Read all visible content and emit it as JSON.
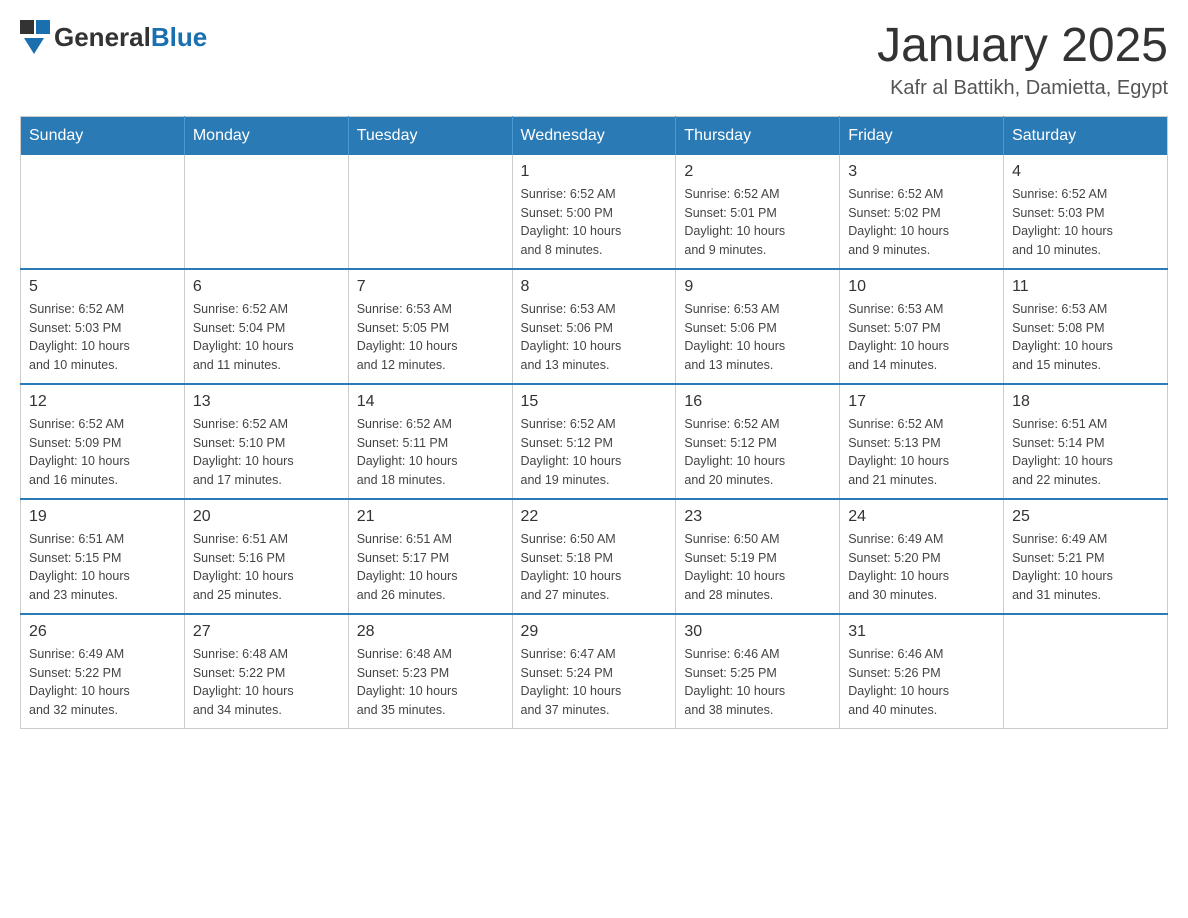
{
  "header": {
    "logo_general": "General",
    "logo_blue": "Blue",
    "title": "January 2025",
    "subtitle": "Kafr al Battikh, Damietta, Egypt"
  },
  "calendar": {
    "days_of_week": [
      "Sunday",
      "Monday",
      "Tuesday",
      "Wednesday",
      "Thursday",
      "Friday",
      "Saturday"
    ],
    "weeks": [
      [
        {
          "day": "",
          "info": ""
        },
        {
          "day": "",
          "info": ""
        },
        {
          "day": "",
          "info": ""
        },
        {
          "day": "1",
          "info": "Sunrise: 6:52 AM\nSunset: 5:00 PM\nDaylight: 10 hours\nand 8 minutes."
        },
        {
          "day": "2",
          "info": "Sunrise: 6:52 AM\nSunset: 5:01 PM\nDaylight: 10 hours\nand 9 minutes."
        },
        {
          "day": "3",
          "info": "Sunrise: 6:52 AM\nSunset: 5:02 PM\nDaylight: 10 hours\nand 9 minutes."
        },
        {
          "day": "4",
          "info": "Sunrise: 6:52 AM\nSunset: 5:03 PM\nDaylight: 10 hours\nand 10 minutes."
        }
      ],
      [
        {
          "day": "5",
          "info": "Sunrise: 6:52 AM\nSunset: 5:03 PM\nDaylight: 10 hours\nand 10 minutes."
        },
        {
          "day": "6",
          "info": "Sunrise: 6:52 AM\nSunset: 5:04 PM\nDaylight: 10 hours\nand 11 minutes."
        },
        {
          "day": "7",
          "info": "Sunrise: 6:53 AM\nSunset: 5:05 PM\nDaylight: 10 hours\nand 12 minutes."
        },
        {
          "day": "8",
          "info": "Sunrise: 6:53 AM\nSunset: 5:06 PM\nDaylight: 10 hours\nand 13 minutes."
        },
        {
          "day": "9",
          "info": "Sunrise: 6:53 AM\nSunset: 5:06 PM\nDaylight: 10 hours\nand 13 minutes."
        },
        {
          "day": "10",
          "info": "Sunrise: 6:53 AM\nSunset: 5:07 PM\nDaylight: 10 hours\nand 14 minutes."
        },
        {
          "day": "11",
          "info": "Sunrise: 6:53 AM\nSunset: 5:08 PM\nDaylight: 10 hours\nand 15 minutes."
        }
      ],
      [
        {
          "day": "12",
          "info": "Sunrise: 6:52 AM\nSunset: 5:09 PM\nDaylight: 10 hours\nand 16 minutes."
        },
        {
          "day": "13",
          "info": "Sunrise: 6:52 AM\nSunset: 5:10 PM\nDaylight: 10 hours\nand 17 minutes."
        },
        {
          "day": "14",
          "info": "Sunrise: 6:52 AM\nSunset: 5:11 PM\nDaylight: 10 hours\nand 18 minutes."
        },
        {
          "day": "15",
          "info": "Sunrise: 6:52 AM\nSunset: 5:12 PM\nDaylight: 10 hours\nand 19 minutes."
        },
        {
          "day": "16",
          "info": "Sunrise: 6:52 AM\nSunset: 5:12 PM\nDaylight: 10 hours\nand 20 minutes."
        },
        {
          "day": "17",
          "info": "Sunrise: 6:52 AM\nSunset: 5:13 PM\nDaylight: 10 hours\nand 21 minutes."
        },
        {
          "day": "18",
          "info": "Sunrise: 6:51 AM\nSunset: 5:14 PM\nDaylight: 10 hours\nand 22 minutes."
        }
      ],
      [
        {
          "day": "19",
          "info": "Sunrise: 6:51 AM\nSunset: 5:15 PM\nDaylight: 10 hours\nand 23 minutes."
        },
        {
          "day": "20",
          "info": "Sunrise: 6:51 AM\nSunset: 5:16 PM\nDaylight: 10 hours\nand 25 minutes."
        },
        {
          "day": "21",
          "info": "Sunrise: 6:51 AM\nSunset: 5:17 PM\nDaylight: 10 hours\nand 26 minutes."
        },
        {
          "day": "22",
          "info": "Sunrise: 6:50 AM\nSunset: 5:18 PM\nDaylight: 10 hours\nand 27 minutes."
        },
        {
          "day": "23",
          "info": "Sunrise: 6:50 AM\nSunset: 5:19 PM\nDaylight: 10 hours\nand 28 minutes."
        },
        {
          "day": "24",
          "info": "Sunrise: 6:49 AM\nSunset: 5:20 PM\nDaylight: 10 hours\nand 30 minutes."
        },
        {
          "day": "25",
          "info": "Sunrise: 6:49 AM\nSunset: 5:21 PM\nDaylight: 10 hours\nand 31 minutes."
        }
      ],
      [
        {
          "day": "26",
          "info": "Sunrise: 6:49 AM\nSunset: 5:22 PM\nDaylight: 10 hours\nand 32 minutes."
        },
        {
          "day": "27",
          "info": "Sunrise: 6:48 AM\nSunset: 5:22 PM\nDaylight: 10 hours\nand 34 minutes."
        },
        {
          "day": "28",
          "info": "Sunrise: 6:48 AM\nSunset: 5:23 PM\nDaylight: 10 hours\nand 35 minutes."
        },
        {
          "day": "29",
          "info": "Sunrise: 6:47 AM\nSunset: 5:24 PM\nDaylight: 10 hours\nand 37 minutes."
        },
        {
          "day": "30",
          "info": "Sunrise: 6:46 AM\nSunset: 5:25 PM\nDaylight: 10 hours\nand 38 minutes."
        },
        {
          "day": "31",
          "info": "Sunrise: 6:46 AM\nSunset: 5:26 PM\nDaylight: 10 hours\nand 40 minutes."
        },
        {
          "day": "",
          "info": ""
        }
      ]
    ]
  }
}
